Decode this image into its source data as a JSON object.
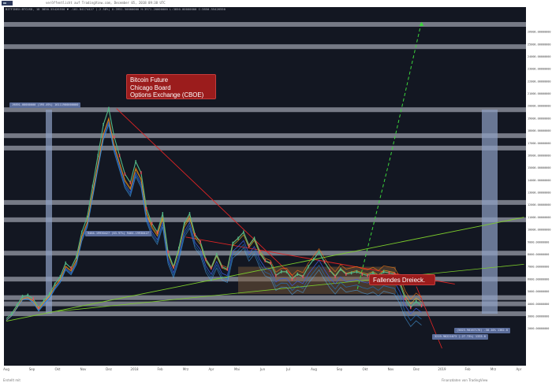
{
  "header": {
    "publisher": "veröffentlicht auf TradingView.com, December 05, 2018 09:38 UTC",
    "symbol_line": "BITFINEX:BTCUSD, 1D 3850.55426550 ▼ -101.84174427 (-2.58%) O:3951.50000000 H:3971.20000000 L:3850.00000000 C:3850.55426550"
  },
  "annotations": {
    "cboe": [
      "Bitcoin Future",
      "Chicago Board",
      "Options Exchange (CBOE)"
    ],
    "triangle": "Fallendes Dreieck."
  },
  "tags": {
    "high": "19891.00000000 (395.49%) 16111900000000",
    "mid": "9464.19930427 (63.97%) 9464.19930427",
    "low1": "(5023.90167176) -30.10% 1382.0",
    "low2": "3219.96221073 (-27.73%) 1333.0"
  },
  "footer": {
    "left": "Erstellt mit",
    "right": "Finanzdaten von TradingView"
  },
  "colors": {
    "background": "#131722",
    "grid_band": "#c8ccd8",
    "price_up": "#53b987",
    "price_down": "#eb4d5c",
    "trend_red": "#e02424",
    "trend_green": "#7ccc2b",
    "projection": "#3bd63b",
    "shade": "#8fa1c4"
  },
  "chart_data": {
    "type": "line",
    "title": "",
    "xlabel": "",
    "ylabel": "",
    "x_ticks": [
      "Aug",
      "Sep",
      "Okt",
      "Nov",
      "Dez",
      "2018",
      "Feb",
      "Mrz",
      "Apr",
      "Mai",
      "Jun",
      "Jul",
      "Aug",
      "Sep",
      "Okt",
      "Nov",
      "Dez",
      "2019",
      "Feb",
      "Mrz",
      "Apr"
    ],
    "ylim": [
      -1000,
      28000
    ],
    "y_ticks": [
      26000,
      25000,
      24000,
      23000,
      22000,
      21000,
      20000,
      19000,
      18000,
      17000,
      16000,
      15000,
      14000,
      13000,
      12000,
      11000,
      10000,
      9000,
      8000,
      7000,
      6000,
      5000,
      4000,
      3000,
      2000
    ],
    "series": [
      {
        "values": [
          2800,
          3200,
          3900,
          4600,
          4700,
          4400,
          3700,
          4300,
          4800,
          5600,
          6200,
          7300,
          6900,
          7800,
          9800,
          11000,
          13500,
          16000,
          18500,
          19800,
          17500,
          16000,
          14500,
          13800,
          15500,
          14600,
          11700,
          10500,
          9800,
          11300,
          8200,
          7000,
          8500,
          10500,
          11300,
          9600,
          9000,
          7600,
          6900,
          8000,
          7000,
          6800,
          8900,
          9300,
          9800,
          8700,
          9300,
          8200,
          7500,
          7300,
          6300,
          6600,
          6600,
          6000,
          6400,
          6200,
          7000,
          7600,
          8200,
          7400,
          6700,
          6200,
          6800,
          6400,
          6500,
          6600,
          6400,
          6300,
          6500,
          6200,
          6600,
          6500,
          6400,
          5600,
          4400,
          3700,
          4200,
          3850
        ]
      }
    ],
    "horizontal_levels": [
      26600,
      24800,
      19700,
      17600,
      16600,
      12200,
      10800,
      8100,
      6000,
      4500,
      4000,
      3200
    ]
  }
}
